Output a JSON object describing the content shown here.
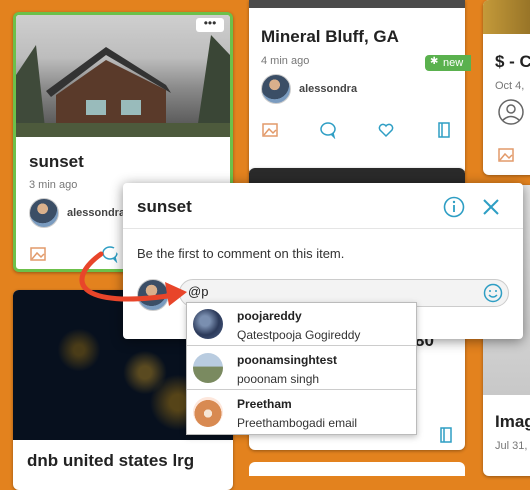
{
  "cards": {
    "sunset": {
      "title": "sunset",
      "time": "3 min ago",
      "author": "alessondra",
      "menu": "•••"
    },
    "mineral": {
      "title": "Mineral Bluff, GA",
      "time": "4 min ago",
      "author": "alessondra",
      "badge": "new"
    },
    "dollar": {
      "title": "$ - C",
      "time": "Oct 4,"
    },
    "dnb": {
      "title": "dnb united states lrg"
    },
    "image": {
      "title": "Imag",
      "time": "Jul 31,"
    },
    "partial": {
      "text": "80"
    }
  },
  "popup": {
    "title": "sunset",
    "message": "Be the first to comment on this item.",
    "comment_value": "@p",
    "info_icon": "info-icon",
    "close_icon": "close-icon",
    "emoji_icon": "smiley-icon"
  },
  "mentions": [
    {
      "handle": "poojareddy",
      "subtitle": "Qatestpooja Gogireddy"
    },
    {
      "handle": "poonamsinghtest",
      "subtitle": "pooonam singh"
    },
    {
      "handle": "Preetham",
      "subtitle": "Preethambogadi email"
    }
  ],
  "colors": {
    "background": "#e3821e",
    "accent": "#2e9ec4",
    "selected_border": "#6cc04a",
    "badge": "#5ab14e",
    "arrow": "#e8452a"
  }
}
